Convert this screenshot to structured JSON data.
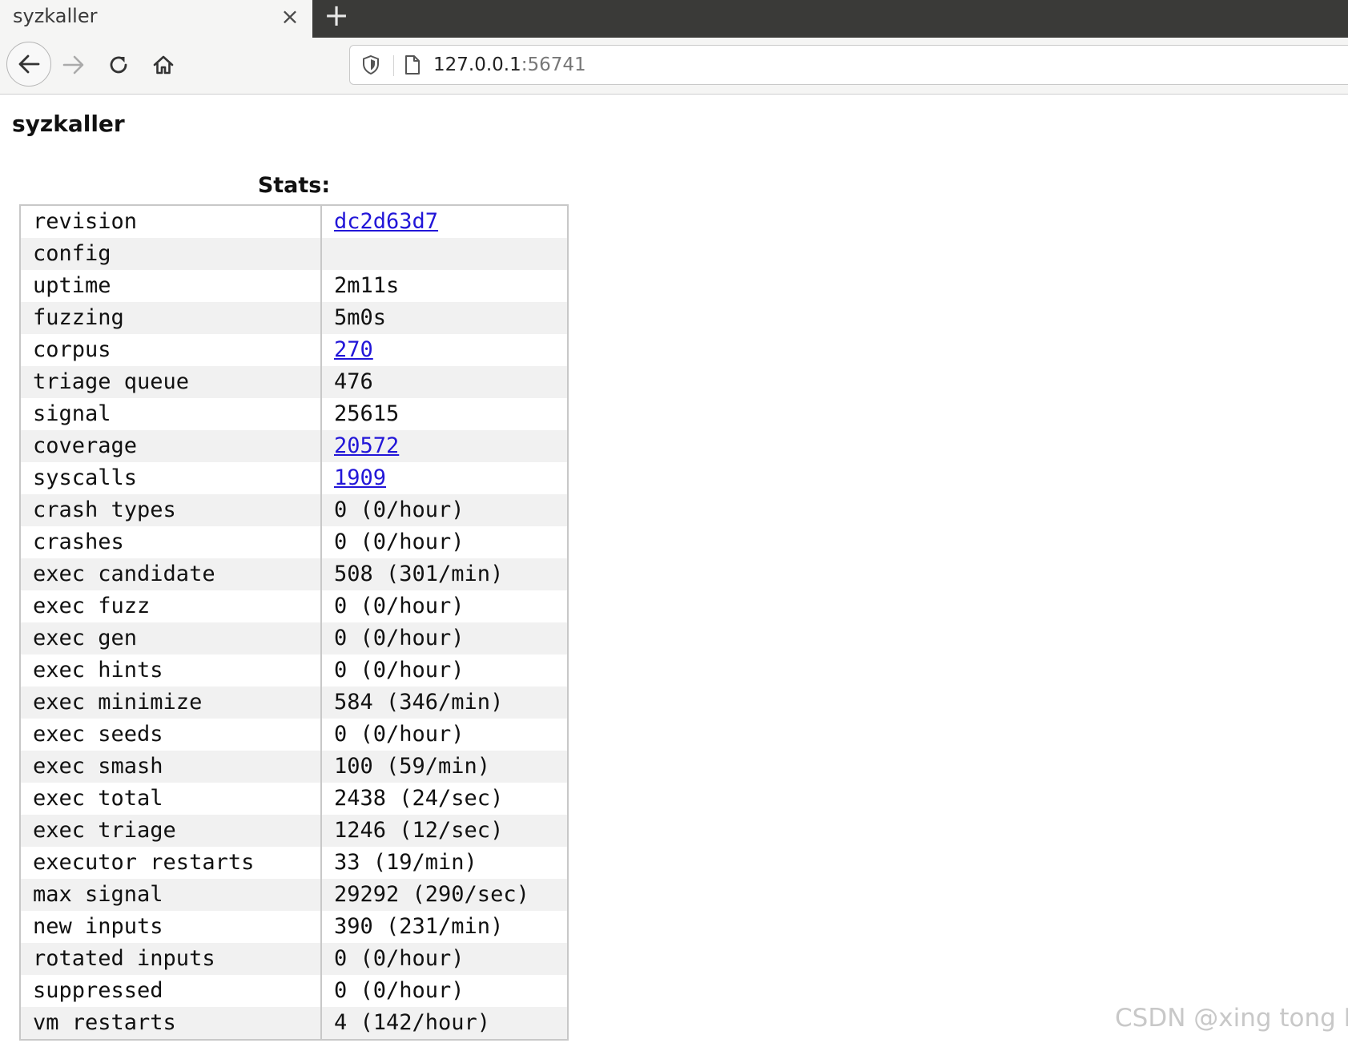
{
  "browser": {
    "tab_title": "syzkaller",
    "close_glyph": "×",
    "new_tab_glyph": "+",
    "url_host": "127.0.0.1",
    "url_port": ":56741",
    "icons": {
      "back": "back-arrow-icon",
      "forward": "forward-arrow-icon",
      "reload": "reload-icon",
      "home": "home-icon",
      "shield": "shield-icon",
      "page": "page-icon"
    }
  },
  "page": {
    "title": "syzkaller",
    "stats_caption": "Stats:"
  },
  "stats": [
    {
      "label": "revision",
      "value": "dc2d63d7",
      "link": true
    },
    {
      "label": "config",
      "value": "",
      "link": false
    },
    {
      "label": "uptime",
      "value": "2m11s",
      "link": false
    },
    {
      "label": "fuzzing",
      "value": "5m0s",
      "link": false
    },
    {
      "label": "corpus",
      "value": "270",
      "link": true
    },
    {
      "label": "triage queue",
      "value": "476",
      "link": false
    },
    {
      "label": "signal",
      "value": "25615",
      "link": false
    },
    {
      "label": "coverage",
      "value": "20572",
      "link": true
    },
    {
      "label": "syscalls",
      "value": "1909",
      "link": true
    },
    {
      "label": "crash types",
      "value": "0 (0/hour)",
      "link": false
    },
    {
      "label": "crashes",
      "value": "0 (0/hour)",
      "link": false
    },
    {
      "label": "exec candidate",
      "value": "508 (301/min)",
      "link": false
    },
    {
      "label": "exec fuzz",
      "value": "0 (0/hour)",
      "link": false
    },
    {
      "label": "exec gen",
      "value": "0 (0/hour)",
      "link": false
    },
    {
      "label": "exec hints",
      "value": "0 (0/hour)",
      "link": false
    },
    {
      "label": "exec minimize",
      "value": "584 (346/min)",
      "link": false
    },
    {
      "label": "exec seeds",
      "value": "0 (0/hour)",
      "link": false
    },
    {
      "label": "exec smash",
      "value": "100 (59/min)",
      "link": false
    },
    {
      "label": "exec total",
      "value": "2438 (24/sec)",
      "link": false
    },
    {
      "label": "exec triage",
      "value": "1246 (12/sec)",
      "link": false
    },
    {
      "label": "executor restarts",
      "value": "33 (19/min)",
      "link": false
    },
    {
      "label": "max signal",
      "value": "29292 (290/sec)",
      "link": false
    },
    {
      "label": "new inputs",
      "value": "390 (231/min)",
      "link": false
    },
    {
      "label": "rotated inputs",
      "value": "0 (0/hour)",
      "link": false
    },
    {
      "label": "suppressed",
      "value": "0 (0/hour)",
      "link": false
    },
    {
      "label": "vm restarts",
      "value": "4 (142/hour)",
      "link": false
    }
  ],
  "watermark": "CSDN @xing tong LI",
  "colors": {
    "link": "#2216d8",
    "tabstrip": "#3a3a38",
    "row_alt": "#f1f1f1",
    "border": "#c8c8c8"
  }
}
